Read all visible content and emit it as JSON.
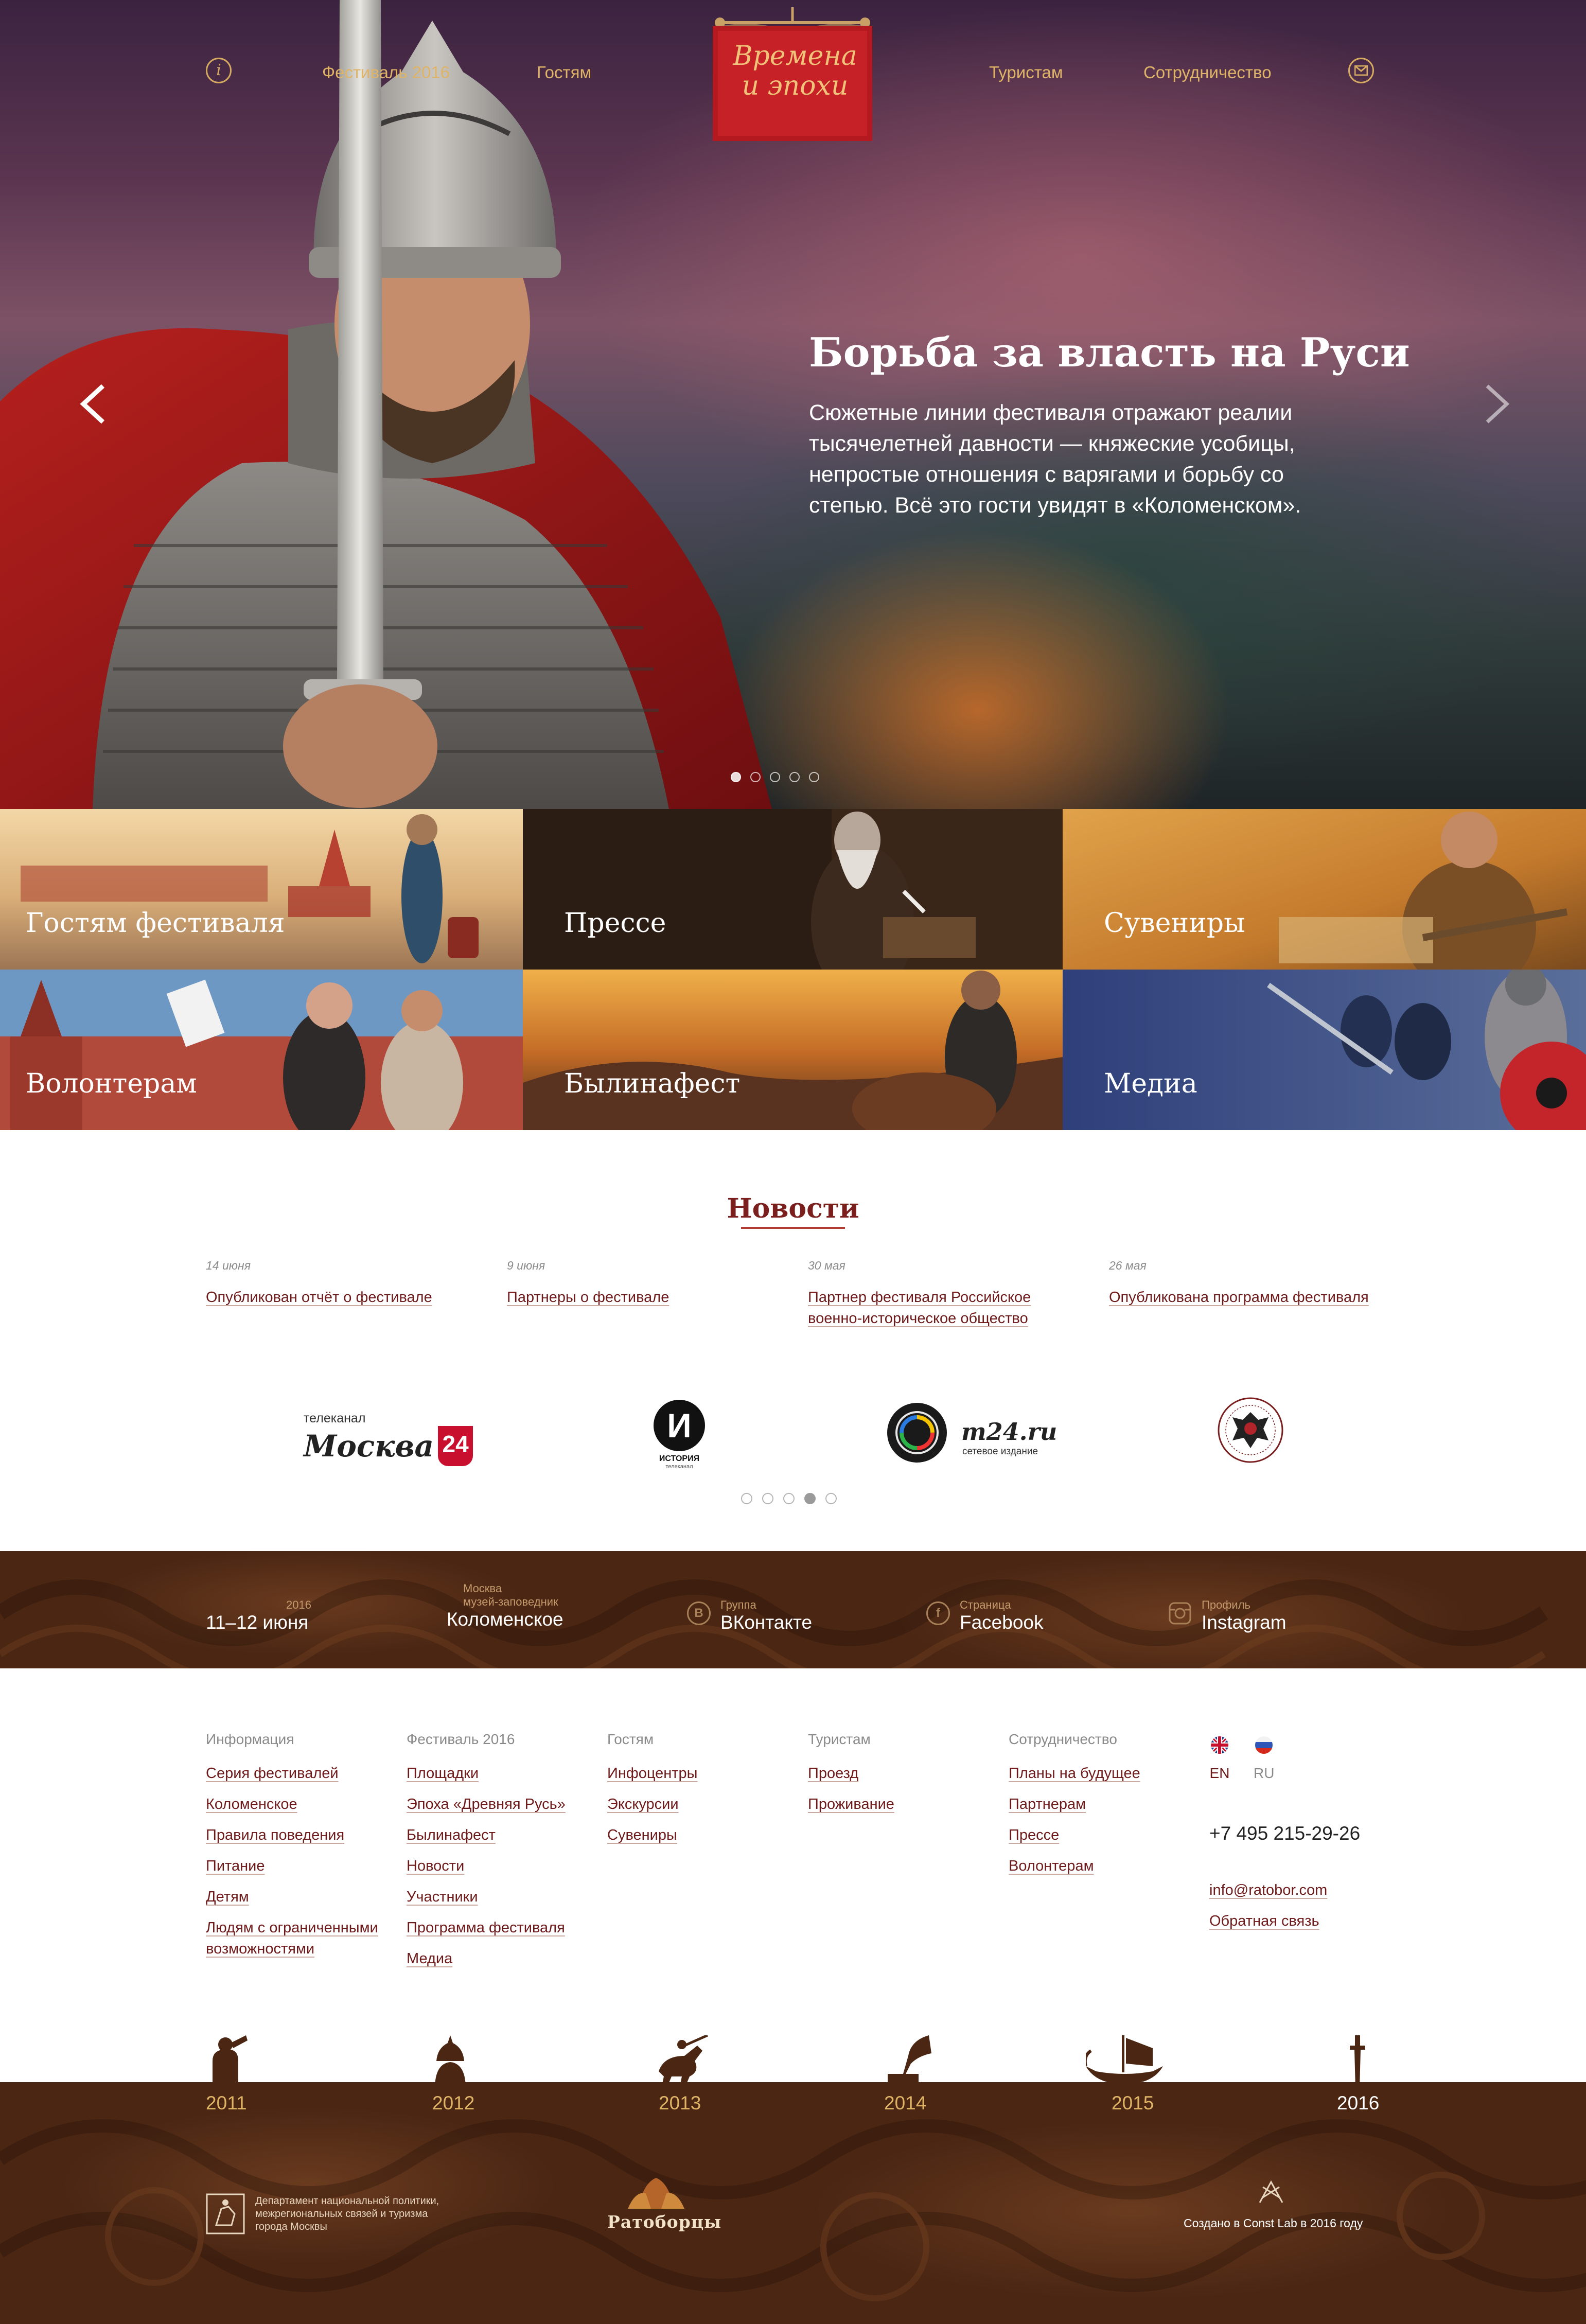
{
  "colors": {
    "accent_gold": "#e0b467",
    "link_dark_red": "#6e1a1a",
    "brown_bar": "#4a2613",
    "news_title": "#7b1e1e"
  },
  "header": {
    "nav_left": [
      "Фестиваль 2016",
      "Гостям"
    ],
    "nav_right": [
      "Туристам",
      "Сотрудничество"
    ],
    "info_icon_glyph": "i",
    "logo_text": "Времена и эпохи",
    "icons": [
      "info-icon",
      "mail-icon"
    ]
  },
  "hero": {
    "title": "Борьба за власть на Руси",
    "text": "Сюжетные линии фестиваля отражают реалии тысячелетней давности — княжеские усобицы, непростые отношения с варягами и борьбу со степью. Всё это гости увидят в «Коломенском».",
    "slides_total": 5,
    "slide_active": 1
  },
  "tiles": [
    "Гостям фестиваля",
    "Прессе",
    "Сувениры",
    "Волонтерам",
    "Былинафест",
    "Медиа"
  ],
  "news": {
    "title": "Новости",
    "items": [
      {
        "date": "14 июня",
        "title": "Опубликован отчёт о фестивале"
      },
      {
        "date": "9 июня",
        "title": "Партнеры о фестивале"
      },
      {
        "date": "30 мая",
        "title": "Партнер фестиваля Российское военно-историческое общество"
      },
      {
        "date": "26 мая",
        "title": "Опубликована программа фестиваля"
      }
    ]
  },
  "partners": {
    "moskva24": {
      "small": "телеканал",
      "name": "Москва",
      "num": "24"
    },
    "istoriya": {
      "letter": "И",
      "caption": "ИСТОРИЯ",
      "sub": "телеканал"
    },
    "m24": {
      "name": "m24.ru",
      "sub": "сетевое издание"
    },
    "slides_total": 5,
    "slide_active": 4
  },
  "infobar": {
    "dates": {
      "small": "2016",
      "big": "11–12 июня"
    },
    "place": {
      "small1": "Москва",
      "small2": "музей-заповедник",
      "big": "Коломенское"
    },
    "vk": {
      "small": "Группа",
      "big": "ВКонтакте",
      "glyph": "B"
    },
    "fb": {
      "small": "Страница",
      "big": "Facebook",
      "glyph": "f"
    },
    "ig": {
      "small": "Профиль",
      "big": "Instagram"
    }
  },
  "footer": {
    "columns": [
      {
        "head": "Информация",
        "links": [
          "Серия фестивалей",
          "Коломенское",
          "Правила поведения",
          "Питание",
          "Детям",
          "Людям с ограниченными возможностями"
        ]
      },
      {
        "head": "Фестиваль 2016",
        "links": [
          "Площадки",
          "Эпоха «Древняя Русь»",
          "Былинафест",
          "Новости",
          "Участники",
          "Программа фестиваля",
          "Медиа"
        ]
      },
      {
        "head": "Гостям",
        "links": [
          "Инфоцентры",
          "Экскурсии",
          "Сувениры"
        ]
      },
      {
        "head": "Туристам",
        "links": [
          "Проезд",
          "Проживание"
        ]
      },
      {
        "head": "Сотрудничество",
        "links": [
          "Планы на будущее",
          "Партнерам",
          "Прессе",
          "Волонтерам"
        ]
      }
    ],
    "lang": [
      "EN",
      "RU"
    ],
    "phone": "+7 495 215-29-26",
    "email": "info@ratobor.com",
    "feedback": "Обратная связь"
  },
  "years": [
    "2011",
    "2012",
    "2013",
    "2014",
    "2015",
    "2016"
  ],
  "bottom": {
    "dept": "Департамент национальной политики, межрегиональных связей и туризма города Москвы",
    "ratobor": "Ратоборцы",
    "credits": "Создано в Const Lab в 2016 году"
  }
}
